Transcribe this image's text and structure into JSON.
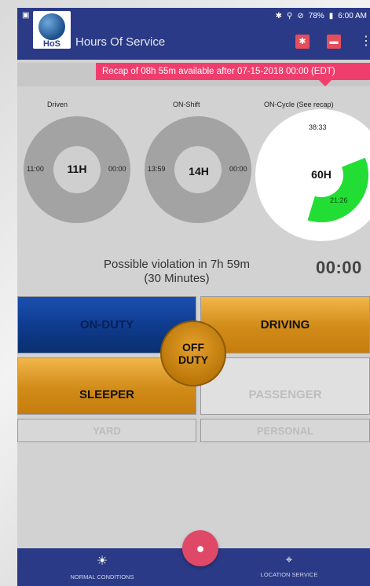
{
  "status_bar": {
    "left_icon": "notification-icon",
    "battery": "78%",
    "time": "6:00 AM"
  },
  "app_bar": {
    "logo_text": "HoS",
    "title": "Hours Of Service",
    "actions": [
      "bluetooth-icon",
      "truck-icon",
      "more-vert-icon"
    ]
  },
  "recap_banner": "Recap of 08h 55m available after 07-15-2018 00:00 (EDT)",
  "gauges": [
    {
      "label": "Driven",
      "center": "11H",
      "left": "11:00",
      "right": "00:00"
    },
    {
      "label": "ON-Shift",
      "center": "14H",
      "left": "13:59",
      "right": "00:00"
    },
    {
      "label": "ON-Cycle (See recap)",
      "center": "60H",
      "top": "38:33",
      "bottom": "21:26",
      "used_fraction": 0.357
    }
  ],
  "violation": {
    "line1": "Possible violation in 7h 59m",
    "line2": "(30 Minutes)"
  },
  "timer": "00:00",
  "duty": {
    "on_duty": "ON-DUTY",
    "driving": "DRIVING",
    "off_duty_line1": "OFF",
    "off_duty_line2": "DUTY",
    "sleeper": "SLEEPER",
    "passenger": "PASSENGER",
    "yard": "YARD",
    "personal": "PERSONAL"
  },
  "bottom_nav": {
    "left_label": "NORMAL CONDITIONS",
    "right_label": "LOCATION SERVICE"
  },
  "colors": {
    "primary": "#2b3a86",
    "accent": "#ef3e6d",
    "cycle_green": "#22dd33",
    "duty_orange": "#d18b18",
    "duty_blue": "#0f3c8f"
  }
}
